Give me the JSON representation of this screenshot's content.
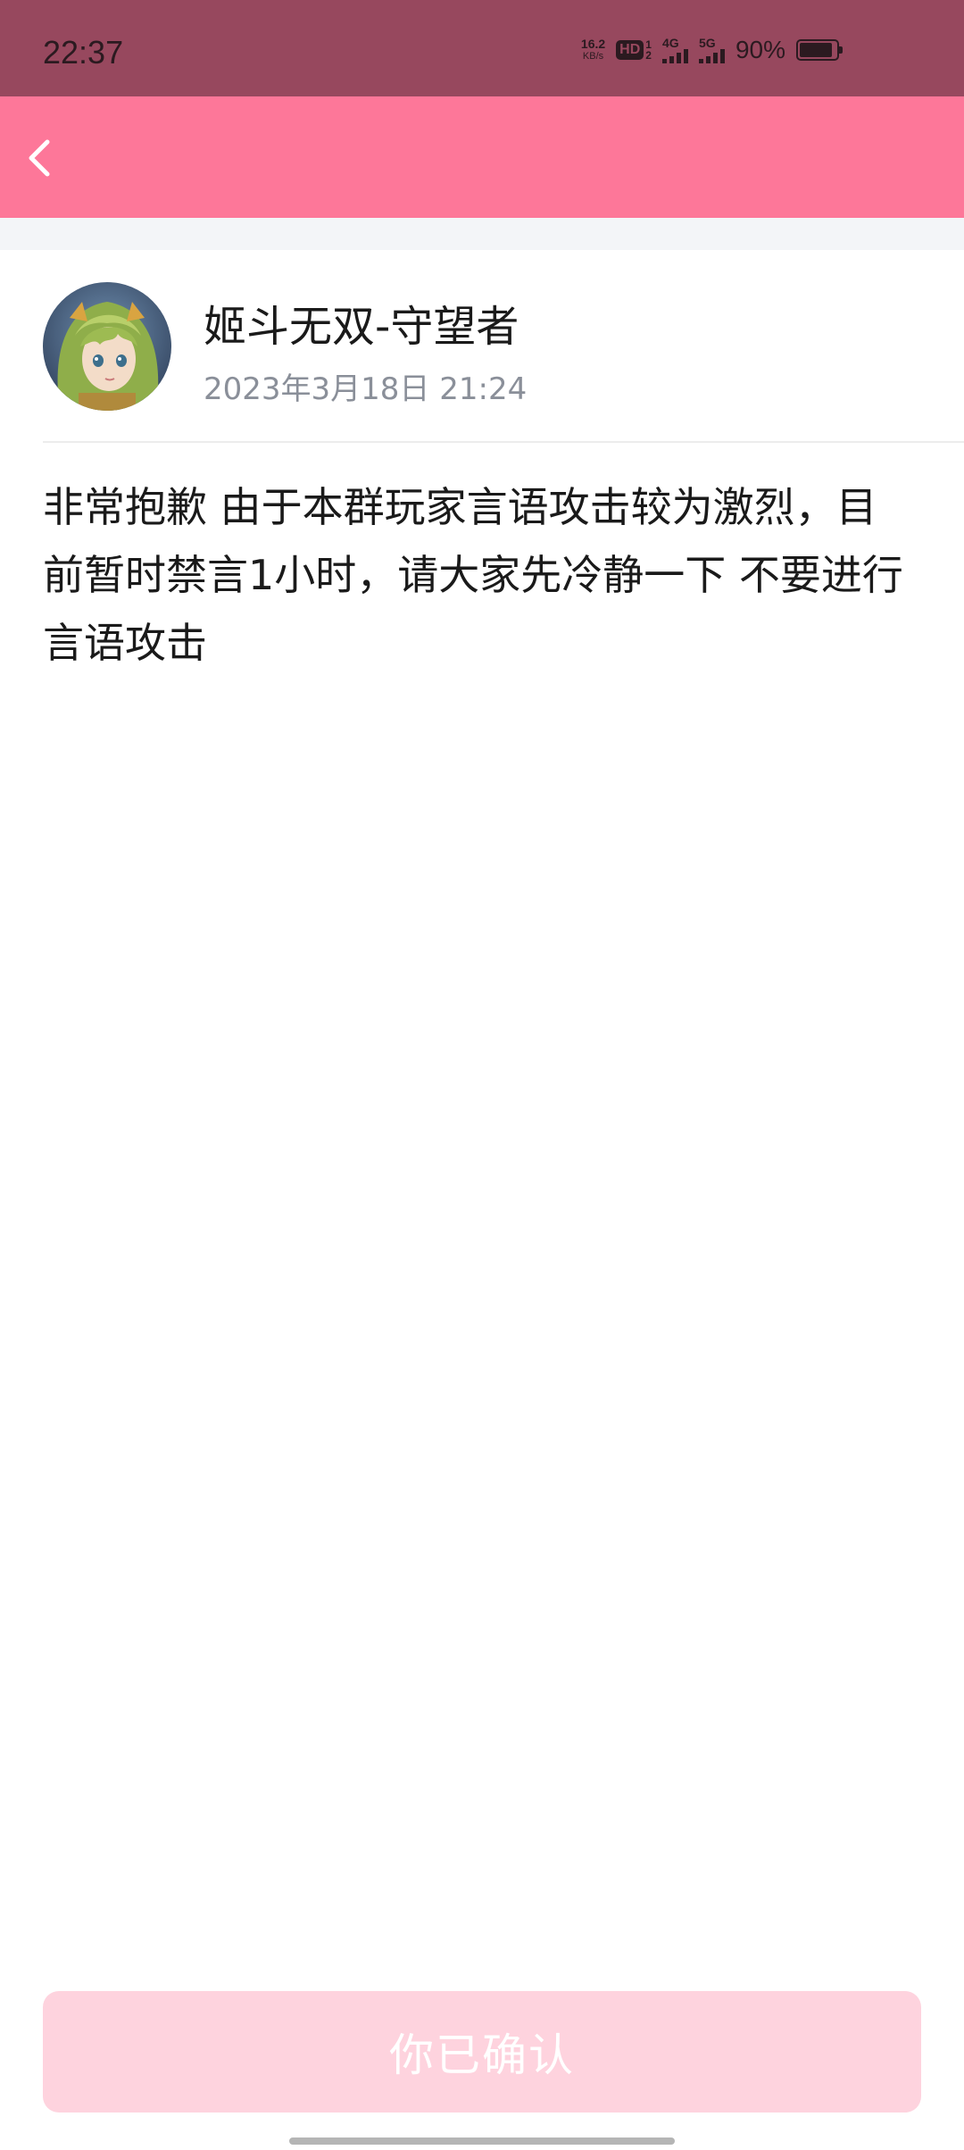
{
  "status_bar": {
    "time": "22:37",
    "net_speed_value": "16.2",
    "net_speed_unit": "KB/s",
    "hd_label": "HD",
    "hd_sub_top": "1",
    "hd_sub_bottom": "2",
    "signal_4g_label": "4G",
    "signal_5g_label": "5G",
    "battery_percent_text": "90%",
    "battery_level": 0.9
  },
  "header": {
    "back_icon": "chevron-left-icon",
    "background_color": "#fd7799"
  },
  "post": {
    "author_name": "姬斗无双-守望者",
    "timestamp": "2023年3月18日 21:24",
    "body": "非常抱歉 由于本群玩家言语攻击较为激烈，目前暂时禁言1小时，请大家先冷静一下 不要进行言语攻击"
  },
  "footer": {
    "confirm_label": "你已确认",
    "confirm_color": "#fed3de"
  }
}
